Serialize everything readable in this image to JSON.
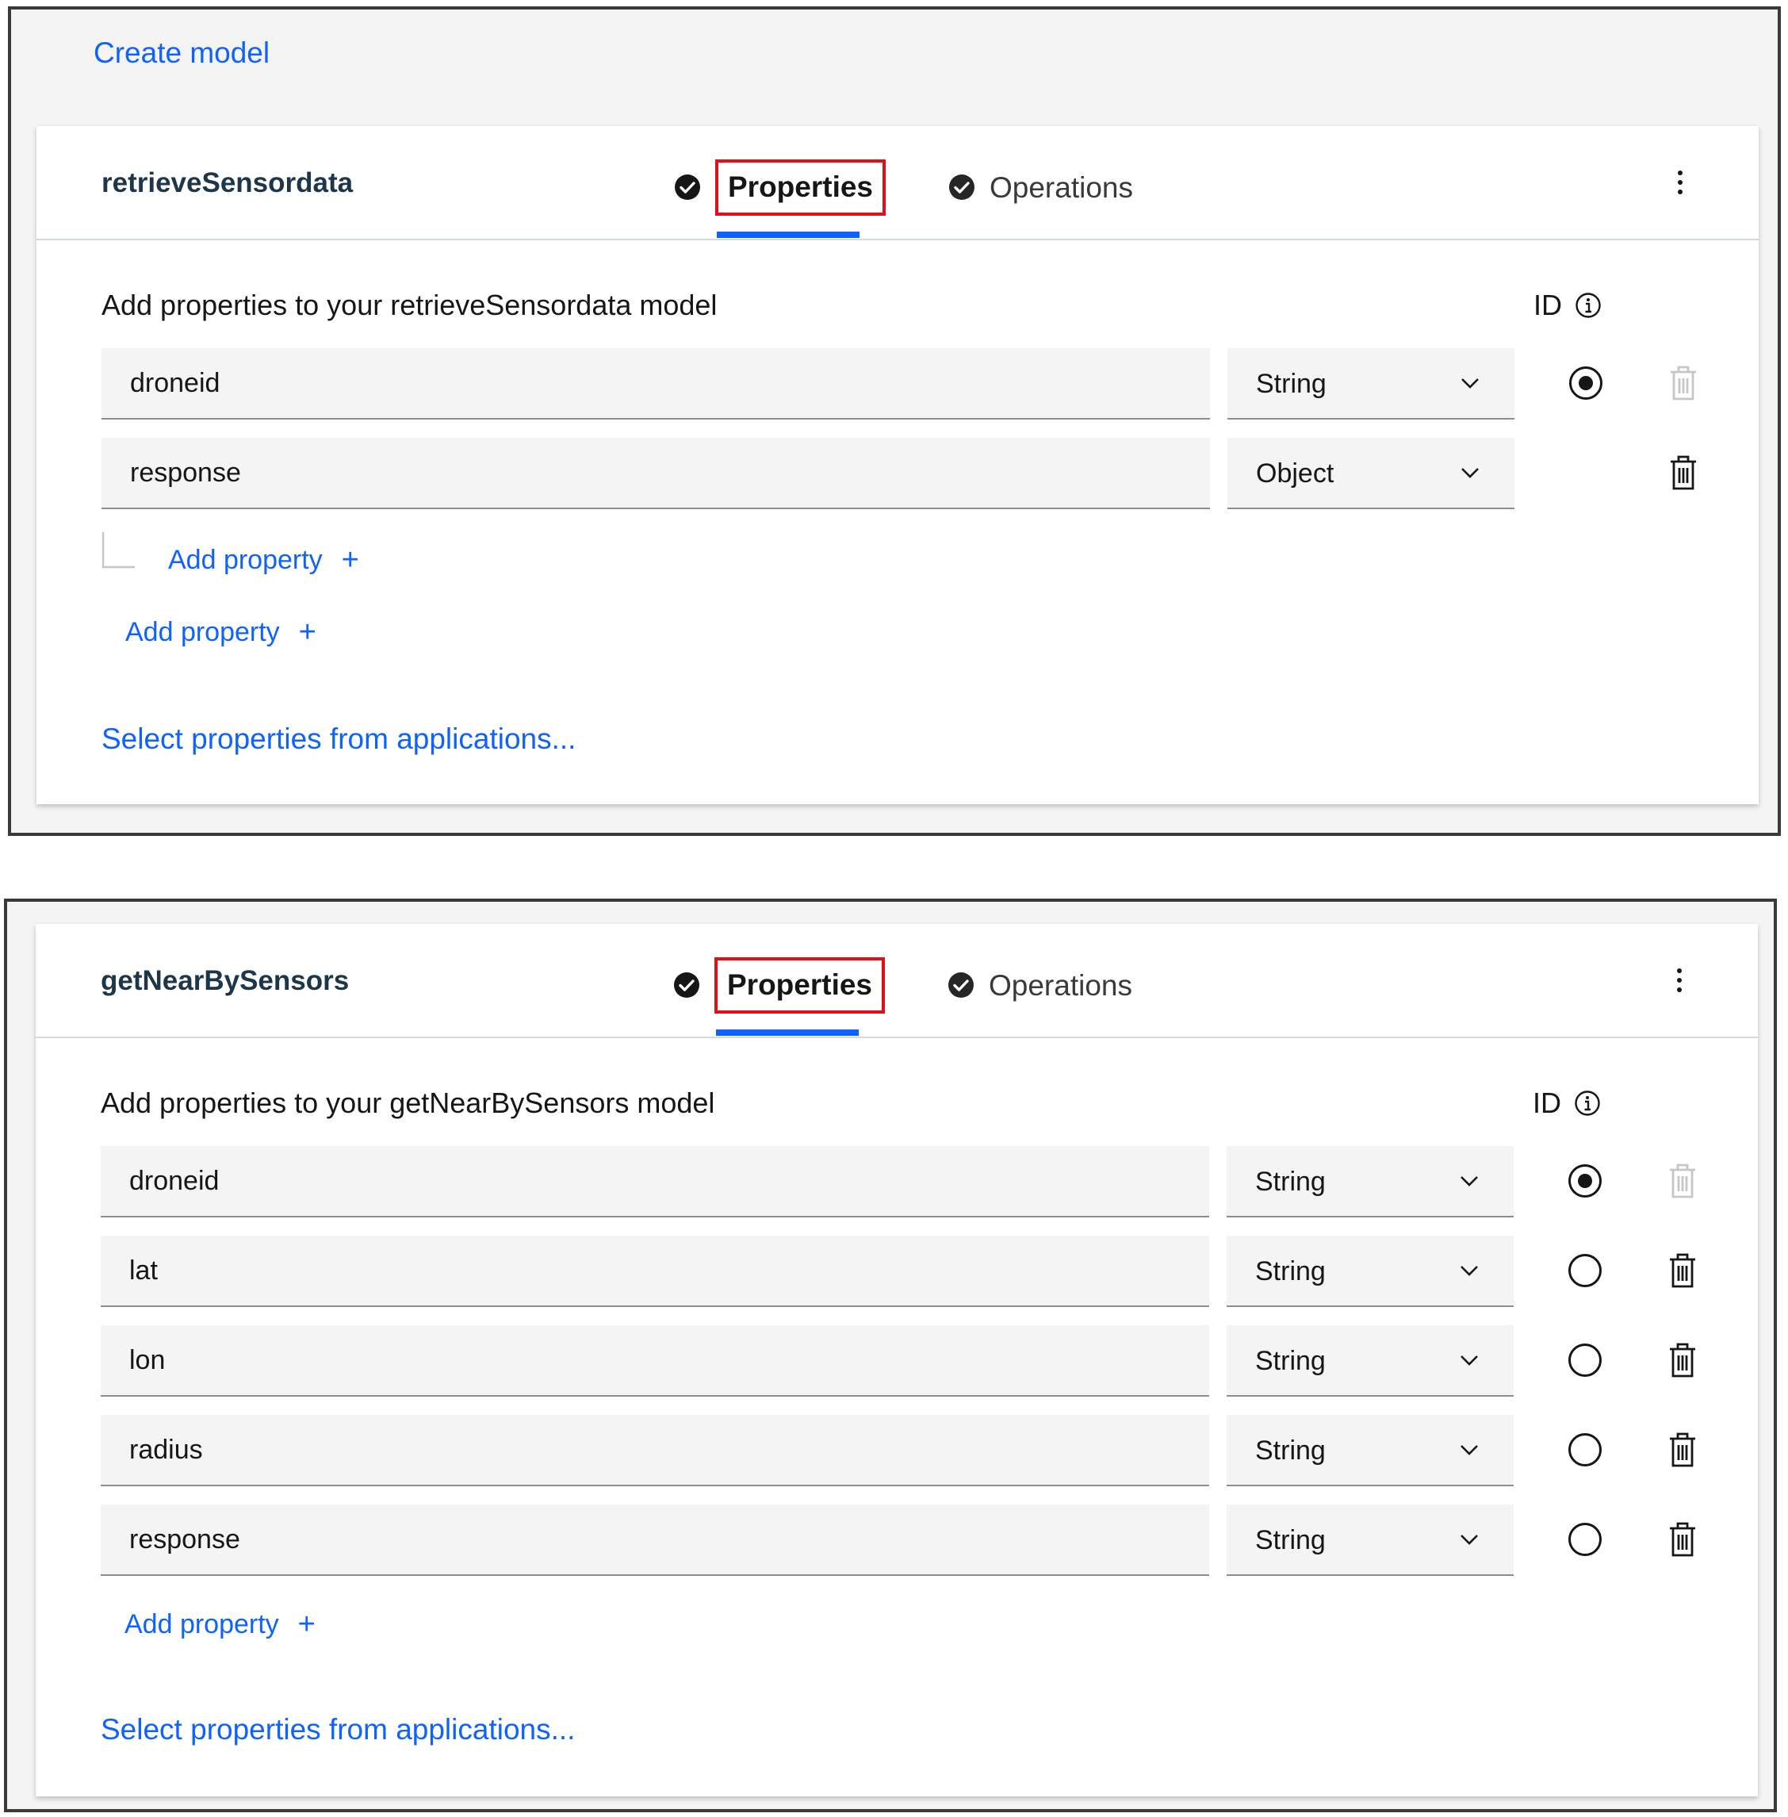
{
  "create_model_link": "Create model",
  "models": [
    {
      "name": "retrieveSensordata",
      "tabs": {
        "properties": "Properties",
        "operations": "Operations"
      },
      "heading": "Add properties to your retrieveSensordata model",
      "id_label": "ID",
      "properties": [
        {
          "name": "droneid",
          "type": "String",
          "is_id": true,
          "delete_enabled": false
        },
        {
          "name": "response",
          "type": "Object",
          "is_id": null,
          "delete_enabled": true
        }
      ],
      "nested_add_property": "Add property",
      "add_property": "Add property",
      "select_from_apps": "Select properties from applications..."
    },
    {
      "name": "getNearBySensors",
      "tabs": {
        "properties": "Properties",
        "operations": "Operations"
      },
      "heading": "Add properties to your getNearBySensors model",
      "id_label": "ID",
      "properties": [
        {
          "name": "droneid",
          "type": "String",
          "is_id": true,
          "delete_enabled": false
        },
        {
          "name": "lat",
          "type": "String",
          "is_id": false,
          "delete_enabled": true
        },
        {
          "name": "lon",
          "type": "String",
          "is_id": false,
          "delete_enabled": true
        },
        {
          "name": "radius",
          "type": "String",
          "is_id": false,
          "delete_enabled": true
        },
        {
          "name": "response",
          "type": "String",
          "is_id": false,
          "delete_enabled": true
        }
      ],
      "add_property": "Add property",
      "select_from_apps": "Select properties from applications..."
    }
  ],
  "colors": {
    "link_blue": "#0f62fe",
    "highlight_red": "#e0101a",
    "field_bg": "#f4f4f4",
    "icon_dark": "#161616",
    "icon_disabled": "#c6c6c6"
  },
  "icons": {
    "tab_status": "checkmark-filled-icon",
    "menu": "overflow-menu-vertical-icon",
    "info": "information-icon",
    "dropdown": "chevron-down-icon",
    "delete": "trash-can-icon",
    "id_select": "radio-button-icon"
  }
}
